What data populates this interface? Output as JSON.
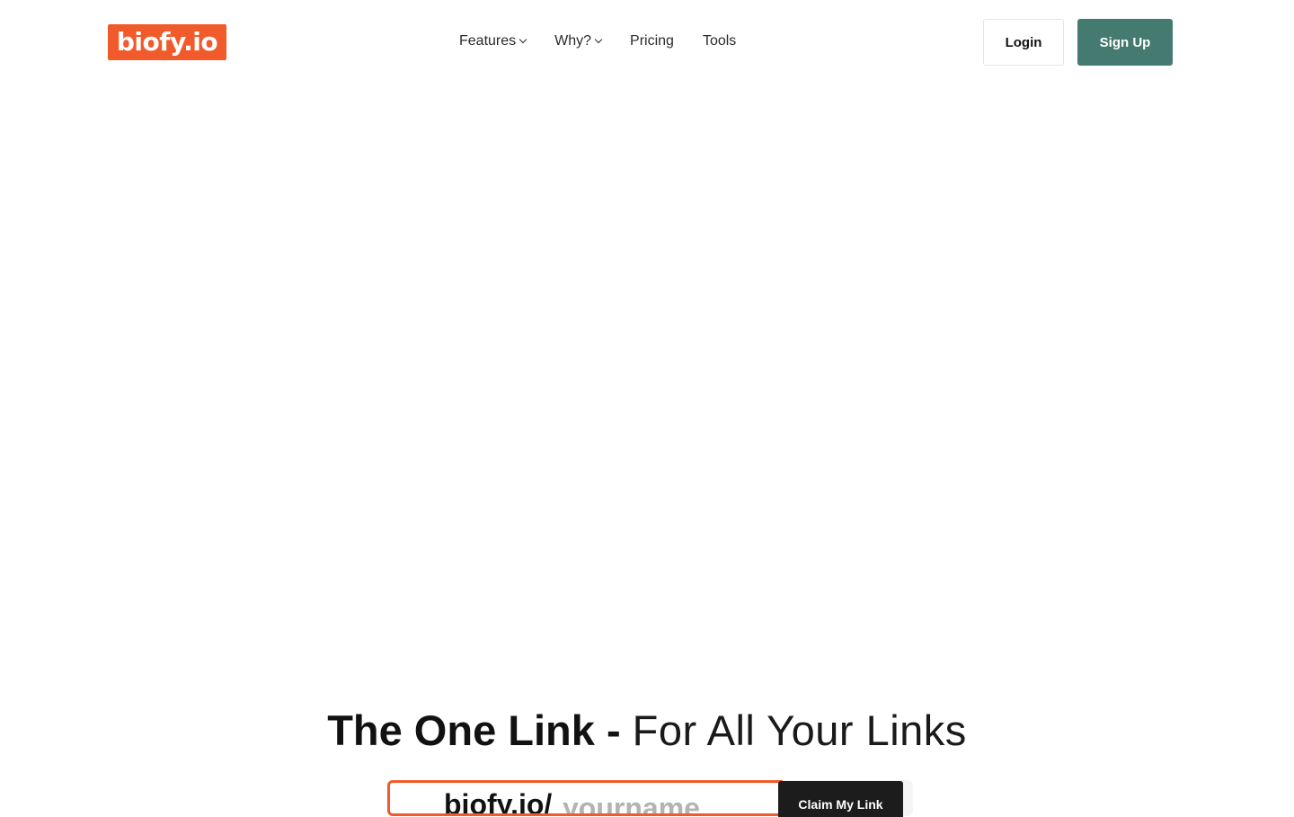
{
  "header": {
    "logo_text": "biofy.io",
    "nav": [
      {
        "label": "Features",
        "has_dropdown": true
      },
      {
        "label": "Why?",
        "has_dropdown": true
      },
      {
        "label": "Pricing",
        "has_dropdown": false
      },
      {
        "label": "Tools",
        "has_dropdown": false
      }
    ],
    "login_label": "Login",
    "signup_label": "Sign Up"
  },
  "hero": {
    "title_strong": "The One Link - ",
    "title_light": "For All Your Links",
    "claim": {
      "prefix": "biofy.io/",
      "placeholder": "yourname",
      "value": "",
      "button_label": "Claim My Link"
    }
  },
  "colors": {
    "brand_orange": "#f15a2b",
    "signup_green": "#447a6f",
    "claim_button": "#1c1c1c",
    "placeholder_gray": "#b3b3b3"
  },
  "icons": {
    "dropdown": "chevron-down-icon"
  }
}
